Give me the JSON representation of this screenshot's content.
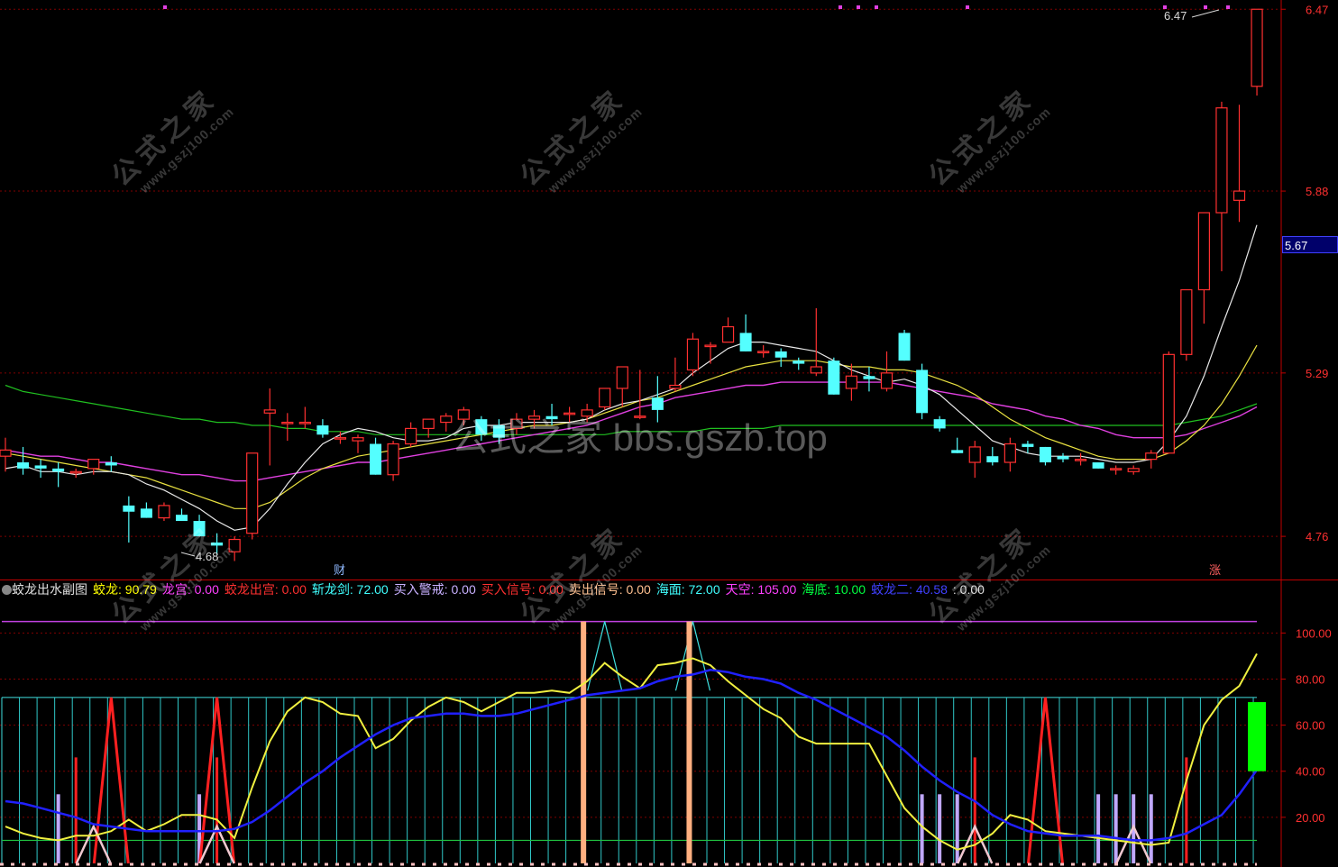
{
  "main_axis": {
    "ticks": [
      "6.47",
      "5.88",
      "5.29",
      "4.76"
    ],
    "current_price": "5.67"
  },
  "annotations": {
    "high_label": "6.47",
    "low_label": "4.68",
    "cai_marker": "财",
    "zhang_marker": "涨"
  },
  "sub_axis": {
    "ticks": [
      "100.00",
      "80.00",
      "60.00",
      "40.00",
      "20.00"
    ]
  },
  "indicator": {
    "title": "蛟龙出水副图",
    "items": [
      {
        "name": "蛟龙",
        "value": "90.79",
        "color": "#ffff00"
      },
      {
        "name": "龙宫",
        "value": "0.00",
        "color": "#ff40ff"
      },
      {
        "name": "蛟龙出宫",
        "value": "0.00",
        "color": "#ff3030"
      },
      {
        "name": "斩龙剑",
        "value": "72.00",
        "color": "#40ffff"
      },
      {
        "name": "买入警戒",
        "value": "0.00",
        "color": "#c8b0ff"
      },
      {
        "name": "买入信号",
        "value": "0.00",
        "color": "#ff3030"
      },
      {
        "name": "卖出信号",
        "value": "0.00",
        "color": "#ffc090"
      },
      {
        "name": "海面",
        "value": "72.00",
        "color": "#40ffff"
      },
      {
        "name": "天空",
        "value": "105.00",
        "color": "#ff40ff"
      },
      {
        "name": "海底",
        "value": "10.00",
        "color": "#00ff40"
      },
      {
        "name": "蛟龙二",
        "value": "40.58",
        "color": "#4040ff"
      },
      {
        "name": "",
        "value": "0.00",
        "color": "#dddddd"
      }
    ]
  },
  "watermarks": {
    "site_cn": "公式之家",
    "site_url": "www.gszj100.com",
    "center_text": "公式之家 bbs.gszb.top"
  },
  "colors": {
    "up": "#ff3030",
    "down": "#54ffff",
    "ma_white": "#e8e8e8",
    "ma_yellow": "#e8e040",
    "ma_magenta": "#e040e0",
    "ma_green": "#20c020",
    "grid": "#800000"
  },
  "chart_data": [
    {
      "type": "candlestick",
      "ylim": [
        4.62,
        6.5
      ],
      "ohlc": [
        [
          5.02,
          5.08,
          4.97,
          5.04
        ],
        [
          5.0,
          5.05,
          4.96,
          4.98
        ],
        [
          4.99,
          5.01,
          4.95,
          4.98
        ],
        [
          4.98,
          5.0,
          4.92,
          4.97
        ],
        [
          4.97,
          4.98,
          4.95,
          4.97
        ],
        [
          4.98,
          5.01,
          4.96,
          5.01
        ],
        [
          5.0,
          5.02,
          4.97,
          4.99
        ],
        [
          4.86,
          4.89,
          4.74,
          4.84
        ],
        [
          4.85,
          4.87,
          4.82,
          4.82
        ],
        [
          4.82,
          4.87,
          4.81,
          4.86
        ],
        [
          4.83,
          4.85,
          4.81,
          4.81
        ],
        [
          4.81,
          4.83,
          4.76,
          4.76
        ],
        [
          4.74,
          4.77,
          4.7,
          4.73
        ],
        [
          4.71,
          4.76,
          4.68,
          4.75
        ],
        [
          4.77,
          5.03,
          4.75,
          5.03
        ],
        [
          5.16,
          5.24,
          4.99,
          5.17
        ],
        [
          5.13,
          5.16,
          5.07,
          5.13
        ],
        [
          5.13,
          5.18,
          5.11,
          5.13
        ],
        [
          5.12,
          5.14,
          5.08,
          5.09
        ],
        [
          5.08,
          5.1,
          5.06,
          5.08
        ],
        [
          5.07,
          5.09,
          5.03,
          5.08
        ],
        [
          5.06,
          5.08,
          4.96,
          4.96
        ],
        [
          4.96,
          5.07,
          4.94,
          5.06
        ],
        [
          5.06,
          5.13,
          5.05,
          5.11
        ],
        [
          5.11,
          5.14,
          5.08,
          5.14
        ],
        [
          5.13,
          5.16,
          5.1,
          5.15
        ],
        [
          5.14,
          5.18,
          5.12,
          5.17
        ],
        [
          5.14,
          5.15,
          5.07,
          5.09
        ],
        [
          5.12,
          5.14,
          5.06,
          5.08
        ],
        [
          5.11,
          5.16,
          5.09,
          5.14
        ],
        [
          5.14,
          5.17,
          5.11,
          5.15
        ],
        [
          5.15,
          5.19,
          5.12,
          5.14
        ],
        [
          5.16,
          5.18,
          5.13,
          5.16
        ],
        [
          5.15,
          5.19,
          5.13,
          5.17
        ],
        [
          5.18,
          5.24,
          5.17,
          5.24
        ],
        [
          5.24,
          5.27,
          5.18,
          5.31
        ],
        [
          5.15,
          5.3,
          5.14,
          5.15
        ],
        [
          5.21,
          5.28,
          5.13,
          5.17
        ],
        [
          5.24,
          5.34,
          5.23,
          5.25
        ],
        [
          5.3,
          5.42,
          5.28,
          5.4
        ],
        [
          5.38,
          5.39,
          5.32,
          5.38
        ],
        [
          5.39,
          5.47,
          5.39,
          5.44
        ],
        [
          5.42,
          5.48,
          5.36,
          5.36
        ],
        [
          5.36,
          5.38,
          5.34,
          5.36
        ],
        [
          5.36,
          5.37,
          5.31,
          5.34
        ],
        [
          5.33,
          5.34,
          5.3,
          5.32
        ],
        [
          5.29,
          5.5,
          5.28,
          5.31
        ],
        [
          5.33,
          5.34,
          5.22,
          5.22
        ],
        [
          5.24,
          5.32,
          5.2,
          5.28
        ],
        [
          5.28,
          5.31,
          5.23,
          5.27
        ],
        [
          5.24,
          5.36,
          5.23,
          5.29
        ],
        [
          5.42,
          5.43,
          5.33,
          5.33
        ],
        [
          5.3,
          5.32,
          5.14,
          5.16
        ],
        [
          5.14,
          5.15,
          5.1,
          5.11
        ],
        [
          5.04,
          5.08,
          5.03,
          5.03
        ],
        [
          5.0,
          5.07,
          4.95,
          5.05
        ],
        [
          5.02,
          5.05,
          4.99,
          5.0
        ],
        [
          5.0,
          5.08,
          4.97,
          5.06
        ],
        [
          5.06,
          5.07,
          5.03,
          5.05
        ],
        [
          5.05,
          5.05,
          4.99,
          5.0
        ],
        [
          5.02,
          5.03,
          5.0,
          5.01
        ],
        [
          5.01,
          5.03,
          4.99,
          5.01
        ],
        [
          5.0,
          5.0,
          4.98,
          4.98
        ],
        [
          4.98,
          4.99,
          4.96,
          4.98
        ],
        [
          4.97,
          4.99,
          4.96,
          4.98
        ],
        [
          5.01,
          5.04,
          4.98,
          5.03
        ],
        [
          5.03,
          5.36,
          5.03,
          5.35
        ],
        [
          5.35,
          5.56,
          5.33,
          5.56
        ],
        [
          5.56,
          5.81,
          5.45,
          5.81
        ],
        [
          5.81,
          6.17,
          5.62,
          6.15
        ],
        [
          5.85,
          6.16,
          5.78,
          5.88
        ],
        [
          6.22,
          6.47,
          6.19,
          6.47
        ]
      ],
      "ma_white": [
        4.98,
        4.99,
        4.97,
        4.97,
        4.96,
        4.97,
        4.97,
        4.96,
        4.93,
        4.91,
        4.88,
        4.85,
        4.81,
        4.78,
        4.79,
        4.85,
        4.93,
        5.0,
        5.06,
        5.09,
        5.11,
        5.1,
        5.08,
        5.07,
        5.07,
        5.08,
        5.11,
        5.12,
        5.12,
        5.13,
        5.13,
        5.13,
        5.13,
        5.14,
        5.17,
        5.19,
        5.2,
        5.22,
        5.24,
        5.29,
        5.33,
        5.37,
        5.39,
        5.39,
        5.38,
        5.37,
        5.36,
        5.33,
        5.3,
        5.28,
        5.26,
        5.27,
        5.25,
        5.22,
        5.17,
        5.12,
        5.07,
        5.05,
        5.03,
        5.02,
        5.02,
        5.02,
        5.01,
        5.0,
        5.0,
        5.01,
        5.07,
        5.15,
        5.28,
        5.44,
        5.59,
        5.77
      ],
      "ma_yellow": [
        5.03,
        5.02,
        5.01,
        5.0,
        4.99,
        4.98,
        4.97,
        4.96,
        4.95,
        4.93,
        4.91,
        4.89,
        4.87,
        4.85,
        4.85,
        4.87,
        4.91,
        4.95,
        4.98,
        5.0,
        5.02,
        5.03,
        5.04,
        5.05,
        5.06,
        5.07,
        5.08,
        5.09,
        5.1,
        5.11,
        5.12,
        5.12,
        5.13,
        5.14,
        5.16,
        5.18,
        5.2,
        5.21,
        5.23,
        5.25,
        5.27,
        5.29,
        5.31,
        5.32,
        5.33,
        5.33,
        5.33,
        5.32,
        5.31,
        5.31,
        5.3,
        5.3,
        5.29,
        5.27,
        5.25,
        5.22,
        5.18,
        5.14,
        5.11,
        5.08,
        5.06,
        5.04,
        5.02,
        5.01,
        5.01,
        5.01,
        5.03,
        5.07,
        5.12,
        5.19,
        5.28,
        5.38
      ],
      "ma_magenta": [
        5.04,
        5.03,
        5.02,
        5.02,
        5.01,
        5.0,
        5.0,
        4.99,
        4.98,
        4.97,
        4.96,
        4.96,
        4.95,
        4.94,
        4.94,
        4.95,
        4.96,
        4.97,
        4.98,
        4.99,
        5.0,
        5.0,
        5.01,
        5.02,
        5.03,
        5.04,
        5.05,
        5.06,
        5.07,
        5.08,
        5.09,
        5.1,
        5.11,
        5.12,
        5.14,
        5.16,
        5.18,
        5.19,
        5.21,
        5.22,
        5.23,
        5.24,
        5.25,
        5.25,
        5.26,
        5.26,
        5.26,
        5.26,
        5.26,
        5.26,
        5.26,
        5.25,
        5.24,
        5.23,
        5.22,
        5.21,
        5.19,
        5.18,
        5.17,
        5.15,
        5.14,
        5.12,
        5.11,
        5.09,
        5.08,
        5.08,
        5.08,
        5.09,
        5.11,
        5.13,
        5.15,
        5.18
      ],
      "ma_green": [
        5.25,
        5.23,
        5.22,
        5.21,
        5.2,
        5.19,
        5.18,
        5.17,
        5.16,
        5.15,
        5.14,
        5.14,
        5.13,
        5.13,
        5.12,
        5.12,
        5.11,
        5.11,
        5.1,
        5.1,
        5.1,
        5.09,
        5.09,
        5.09,
        5.09,
        5.09,
        5.09,
        5.09,
        5.09,
        5.09,
        5.09,
        5.09,
        5.09,
        5.09,
        5.09,
        5.1,
        5.1,
        5.1,
        5.1,
        5.1,
        5.11,
        5.11,
        5.11,
        5.11,
        5.12,
        5.12,
        5.12,
        5.12,
        5.12,
        5.12,
        5.12,
        5.12,
        5.12,
        5.12,
        5.12,
        5.12,
        5.12,
        5.12,
        5.12,
        5.12,
        5.12,
        5.12,
        5.12,
        5.12,
        5.12,
        5.12,
        5.12,
        5.13,
        5.14,
        5.15,
        5.17,
        5.19
      ]
    },
    {
      "type": "line",
      "ylim": [
        0,
        115
      ],
      "series": [
        {
          "name": "蛟龙",
          "values": [
            16,
            13,
            11,
            10,
            12,
            12,
            14,
            19,
            14,
            17,
            21,
            21,
            19,
            11,
            33,
            53,
            66,
            72,
            70,
            65,
            64,
            50,
            54,
            62,
            68,
            72,
            70,
            66,
            70,
            74,
            74,
            75,
            74,
            79,
            87,
            81,
            76,
            86,
            87,
            89,
            86,
            79,
            73,
            67,
            63,
            55,
            52,
            52,
            52,
            52,
            38,
            24,
            16,
            10,
            6,
            8,
            13,
            21,
            19,
            14,
            13,
            12,
            11,
            10,
            9,
            8,
            9,
            36,
            60,
            71,
            77,
            91
          ]
        },
        {
          "name": "蛟龙二",
          "values": [
            27,
            26,
            24,
            22,
            20,
            17,
            16,
            15,
            14,
            14,
            14,
            14,
            14,
            15,
            18,
            23,
            29,
            35,
            40,
            46,
            51,
            56,
            60,
            63,
            64,
            65,
            65,
            64,
            64,
            65,
            67,
            69,
            71,
            73,
            74,
            75,
            76,
            79,
            81,
            82,
            84,
            83,
            81,
            80,
            78,
            74,
            71,
            67,
            63,
            59,
            55,
            49,
            42,
            36,
            31,
            27,
            21,
            17,
            14,
            13,
            12,
            12,
            12,
            11,
            10,
            10,
            11,
            13,
            17,
            21,
            30,
            40.58
          ]
        }
      ],
      "constants": {
        "天空": 105,
        "海面": 72,
        "海底": 10
      },
      "buy_warning_bars": [
        3,
        11,
        52,
        53,
        54,
        62,
        63,
        64,
        65
      ],
      "red_bars": [
        4,
        12,
        55,
        67
      ],
      "red_peaks": [
        6,
        12,
        59
      ],
      "white_tri": [
        5,
        12,
        55,
        64
      ],
      "sell_signal_bars": [
        33,
        39
      ],
      "cyan_peaks": [
        34,
        39
      ],
      "green_bar": {
        "top": 70,
        "bottom": 40
      }
    }
  ]
}
